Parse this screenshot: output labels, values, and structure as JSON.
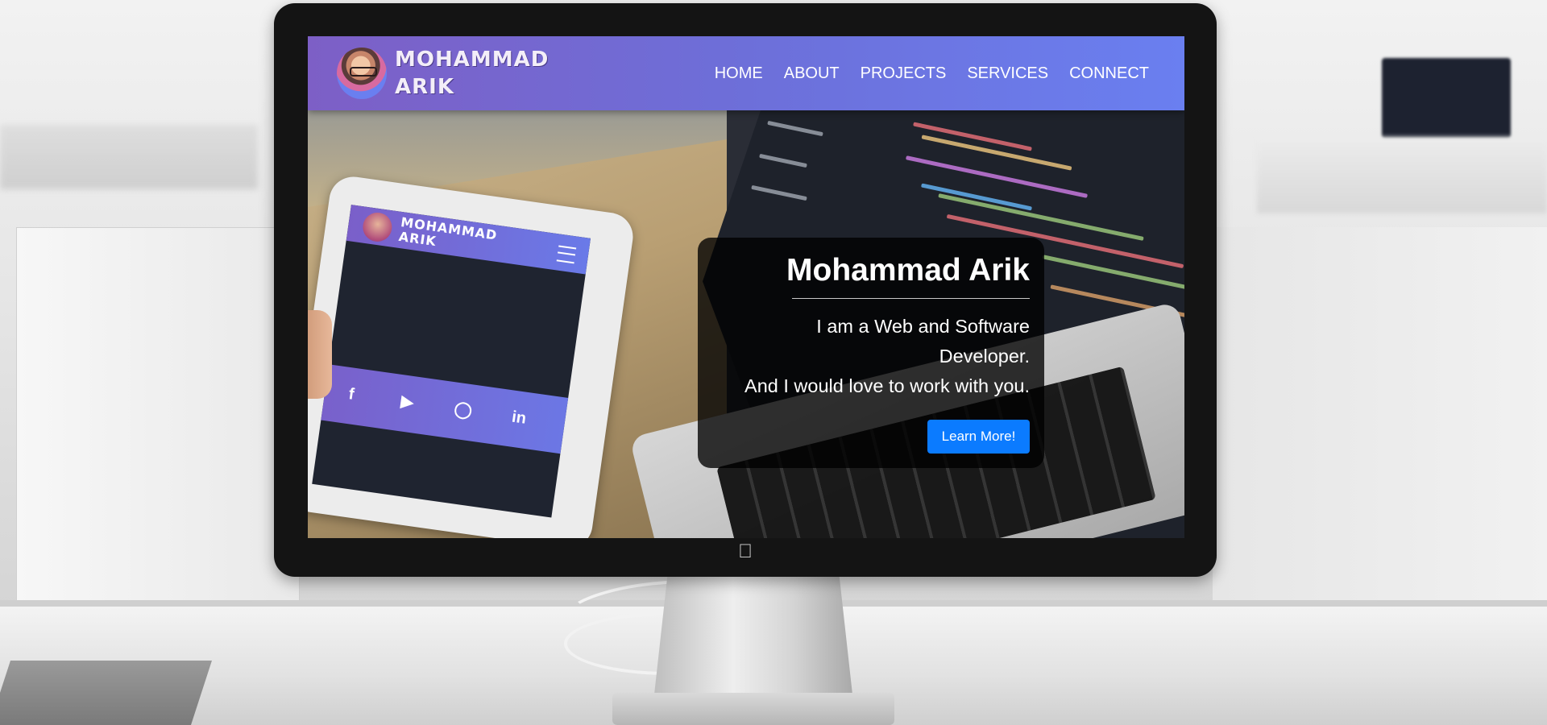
{
  "site": {
    "brand_line1": "MOHAMMAD",
    "brand_line2": "ARIK"
  },
  "nav": {
    "items": [
      {
        "label": "HOME"
      },
      {
        "label": "ABOUT"
      },
      {
        "label": "PROJECTS"
      },
      {
        "label": "SERVICES"
      },
      {
        "label": "CONNECT"
      }
    ]
  },
  "hero": {
    "title": "Mohammad Arik",
    "line1": "I am a Web and Software",
    "line2": "Developer.",
    "line3": "And I would love to work with you.",
    "button_label": "Learn More!"
  },
  "photo": {
    "tablet_brand_line1": "MOHAMMAD",
    "tablet_brand_line2": "ARIK",
    "social_icons": [
      "facebook-icon",
      "youtube-icon",
      "instagram-icon",
      "linkedin-icon"
    ]
  },
  "colors": {
    "nav_gradient_start": "#7d5fc6",
    "nav_gradient_end": "#6a7ff0",
    "button_bg": "#0b7bff",
    "card_bg": "rgba(0,0,0,0.78)"
  }
}
